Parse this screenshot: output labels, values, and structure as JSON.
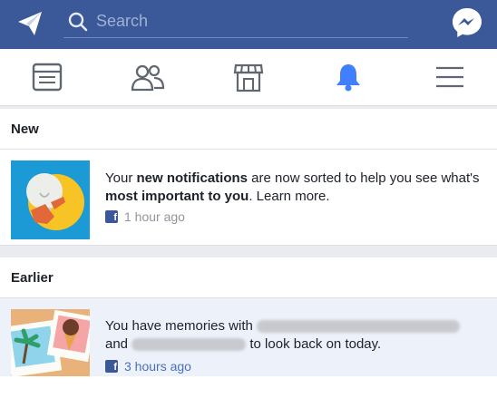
{
  "topbar": {
    "search_placeholder": "Search",
    "compose_icon": "paper-plane-icon",
    "messenger_icon": "messenger-icon"
  },
  "tabs": [
    {
      "name": "news-feed",
      "icon": "news-feed-icon",
      "active": false
    },
    {
      "name": "friends",
      "icon": "friends-icon",
      "active": false
    },
    {
      "name": "marketplace",
      "icon": "marketplace-icon",
      "active": false
    },
    {
      "name": "notifications",
      "icon": "bell-icon",
      "active": true
    },
    {
      "name": "menu",
      "icon": "hamburger-menu-icon",
      "active": false
    }
  ],
  "sections": {
    "new_label": "New",
    "earlier_label": "Earlier"
  },
  "notifications": [
    {
      "text_pre": "Your ",
      "text_bold1": "new notifications",
      "text_mid": " are now sorted to help you see what's ",
      "text_bold2": "most important to you",
      "text_post": ". Learn more.",
      "time": "1 hour ago",
      "unread": false
    },
    {
      "text_pre": "You have memories with",
      "text_and": "and",
      "text_post": "to look back on today.",
      "time": "3 hours ago",
      "unread": true
    }
  ],
  "colors": {
    "brand_blue": "#3b5998",
    "bell_blue": "#4080ff",
    "unread_bg": "#edf2fa",
    "divider": "#dddfe2"
  }
}
